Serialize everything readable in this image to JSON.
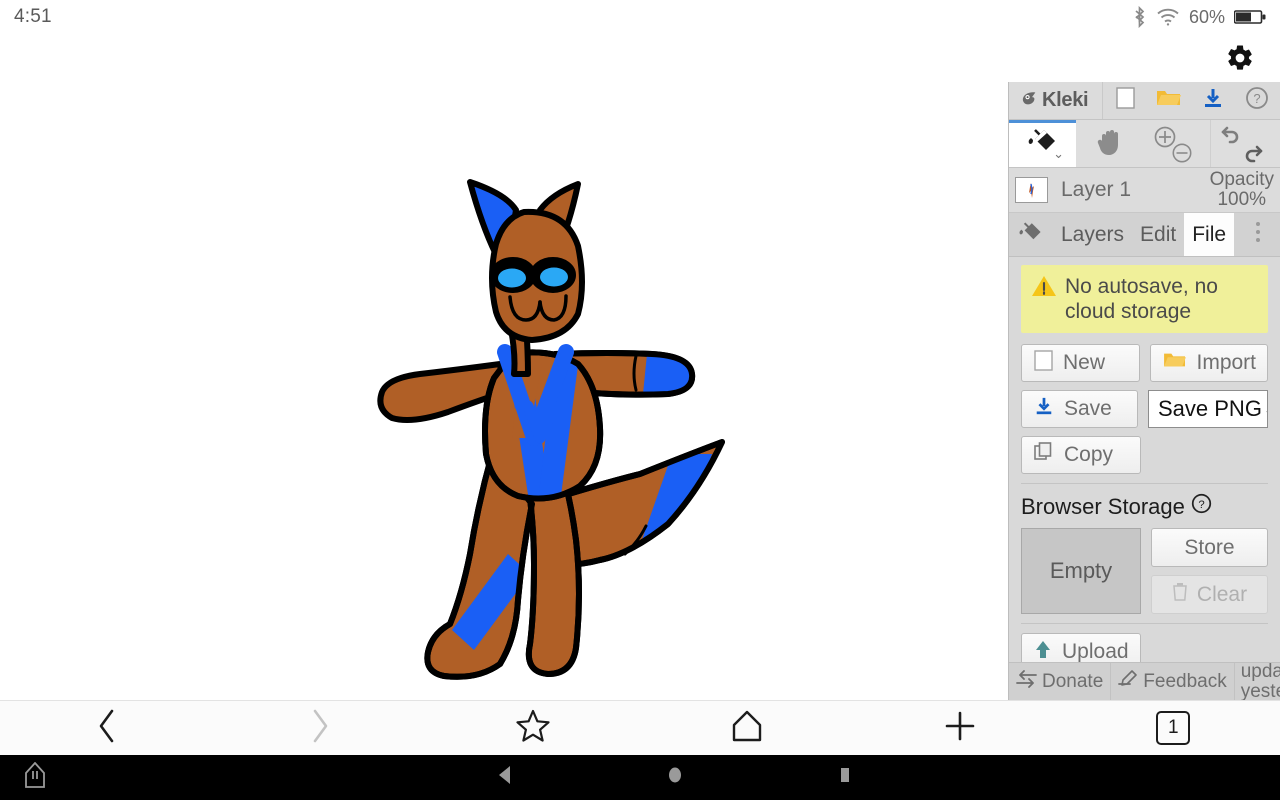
{
  "statusbar": {
    "time": "4:51",
    "battery_percent": "60%",
    "icons": [
      "bluetooth-icon",
      "wifi-icon",
      "battery-icon"
    ]
  },
  "browser": {
    "settings_icon": "gear-icon",
    "bottom_toolbar": {
      "back_label": "Back",
      "forward_label": "Forward",
      "bookmark_label": "Bookmark",
      "home_label": "Home",
      "newtab_label": "New tab",
      "tab_count": "1"
    }
  },
  "kleki": {
    "logo_text": "Kleki",
    "topbar_buttons": [
      {
        "name": "new-image-button",
        "icon": "blank-page-icon"
      },
      {
        "name": "open-file-button",
        "icon": "folder-icon"
      },
      {
        "name": "save-button",
        "icon": "download-icon"
      },
      {
        "name": "help-button",
        "icon": "question-circle-icon"
      }
    ],
    "tools": [
      {
        "name": "paint-bucket-tool",
        "icon": "paint-bucket-icon",
        "active": true
      },
      {
        "name": "hand-tool",
        "icon": "hand-icon",
        "active": false
      },
      {
        "name": "zoom-in-button",
        "icon": "plus-circle-icon",
        "active": false
      },
      {
        "name": "zoom-out-button",
        "icon": "minus-circle-icon",
        "active": false
      },
      {
        "name": "undo-button",
        "icon": "undo-arrow-icon",
        "active": false
      },
      {
        "name": "redo-button",
        "icon": "redo-arrow-icon",
        "active": false
      }
    ],
    "layer": {
      "name": "Layer 1",
      "opacity_label": "Opacity",
      "opacity_value": "100%"
    },
    "tabs": [
      {
        "label": "Layers",
        "active": false
      },
      {
        "label": "Edit",
        "active": false
      },
      {
        "label": "File",
        "active": true
      }
    ],
    "kebab_icon": "more-vertical-icon",
    "warning": {
      "icon": "warning-triangle-icon",
      "line1": "No autosave, no",
      "line2": "cloud storage",
      "bg_color": "#f0f09a"
    },
    "file_actions": {
      "new_label": "New",
      "import_label": "Import",
      "save_label": "Save",
      "format_select_value": "Save PNG",
      "copy_label": "Copy"
    },
    "browser_storage": {
      "title": "Browser Storage",
      "help_icon": "question-circle-icon",
      "empty_label": "Empty",
      "store_label": "Store",
      "clear_label": "Clear",
      "clear_disabled": true
    },
    "upload_label": "Upload",
    "footer": {
      "donate_label": "Donate",
      "feedback_label": "Feedback",
      "updated_line1": "updated",
      "updated_line2": "yesterday"
    }
  },
  "artwork": {
    "title": "fox character drawing",
    "body_color": "#b05f26",
    "marking_color": "#1a5ff5",
    "eye_color": "#2aa8f5",
    "outline_color": "#000000",
    "background_color": "#ffffff"
  }
}
